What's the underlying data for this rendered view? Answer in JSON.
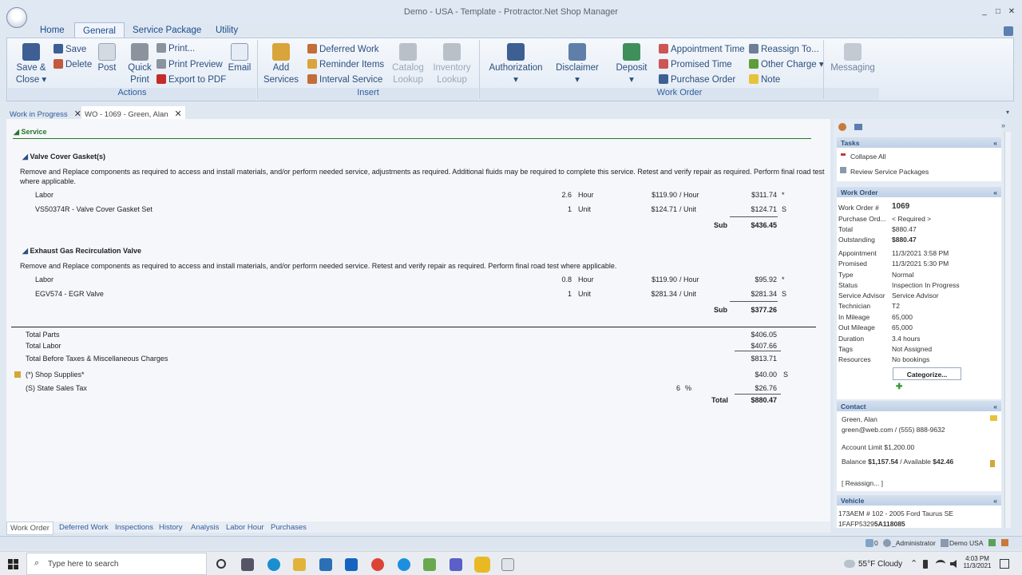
{
  "window": {
    "title": "Demo - USA - Template - Protractor.Net Shop Manager",
    "minimize": "_",
    "restore": "□",
    "close": "✕"
  },
  "ribbon_tabs": [
    "Home",
    "General",
    "Service Package",
    "Utility"
  ],
  "actions": {
    "save_close": "Save &",
    "close": "Close",
    "save": "Save",
    "delete": "Delete",
    "post": "Post",
    "print": "Print...",
    "print_preview": "Print Preview",
    "export_pdf": "Export to PDF",
    "quick": "Quick",
    "print2": "Print",
    "email": "Email",
    "group": "Actions"
  },
  "insert": {
    "add": "Add",
    "services": "Services",
    "deferred": "Deferred Work",
    "reminder": "Reminder Items",
    "interval": "Interval Service",
    "catalog": "Catalog",
    "lookup1": "Lookup",
    "inventory": "Inventory",
    "lookup2": "Lookup",
    "group": "Insert"
  },
  "workorder_grp": {
    "authorization": "Authorization",
    "disclaimer": "Disclaimer",
    "deposit": "Deposit",
    "appointment_time": "Appointment Time",
    "promised_time": "Promised Time",
    "purchase_order": "Purchase Order",
    "reassign": "Reassign To...",
    "other_charge": "Other Charge",
    "note": "Note",
    "messaging": "Messaging",
    "group": "Work Order"
  },
  "doc_tabs": [
    "Work in Progress",
    "WO - 1069 - Green, Alan"
  ],
  "service": {
    "header": "Service",
    "items": [
      {
        "title": "Valve Cover Gasket(s)",
        "desc1": "Remove and Replace components as required to access and install materials, and/or perform needed service, adjustments as required.  Additional fluids may be required to complete this service.  Retest and verify repair as required.  Perform final road test",
        "desc2": "where applicable.",
        "lines": [
          {
            "desc": "Labor",
            "qty": "2.6",
            "unit": "Hour",
            "price": "$119.90",
            "per": "/ Hour",
            "total": "$311.74",
            "flag": "*"
          },
          {
            "desc": "VS50374R - Valve Cover Gasket Set",
            "qty": "1",
            "unit": "Unit",
            "price": "$124.71",
            "per": "/ Unit",
            "total": "$124.71",
            "flag": "S"
          }
        ],
        "sub_label": "Sub",
        "sub": "$436.45"
      },
      {
        "title": "Exhaust Gas Recirculation Valve",
        "desc1": "Remove and Replace components as required to access and install materials, and/or perform needed service.  Retest and verify repair as required.  Perform final road test where applicable.",
        "desc2": "",
        "lines": [
          {
            "desc": "Labor",
            "qty": "0.8",
            "unit": "Hour",
            "price": "$119.90",
            "per": "/ Hour",
            "total": "$95.92",
            "flag": "*"
          },
          {
            "desc": "EGV574 - EGR Valve",
            "qty": "1",
            "unit": "Unit",
            "price": "$281.34",
            "per": "/ Unit",
            "total": "$281.34",
            "flag": "S"
          }
        ],
        "sub_label": "Sub",
        "sub": "$377.26"
      }
    ]
  },
  "totals": {
    "parts_label": "Total Parts",
    "parts": "$406.05",
    "labor_label": "Total Labor",
    "labor": "$407.66",
    "before_label": "Total Before Taxes & Miscellaneous Charges",
    "before": "$813.71",
    "supplies_label": "(*) Shop Supplies*",
    "supplies": "$40.00",
    "supplies_flag": "S",
    "tax_label": "(S) State Sales Tax",
    "tax_rate": "6",
    "tax_pct": "%",
    "tax": "$26.76",
    "total_label": "Total",
    "total": "$880.47"
  },
  "bottom_tabs": [
    "Work Order",
    "Deferred Work",
    "Inspections",
    "History",
    "Analysis",
    "Labor Hour",
    "Purchases"
  ],
  "panel": {
    "tasks_hdr": "Tasks",
    "collapse": "Collapse All",
    "review": "Review Service Packages",
    "wo_hdr": "Work Order",
    "wo_fields": [
      [
        "Work Order #",
        "1069"
      ],
      [
        "Purchase Ord...",
        "< Required >"
      ],
      [
        "Total",
        "$880.47"
      ],
      [
        "Outstanding",
        "$880.47"
      ],
      [
        "Appointment",
        "11/3/2021 3:58 PM"
      ],
      [
        "Promised",
        "11/3/2021 5:30 PM"
      ],
      [
        "Type",
        "Normal"
      ],
      [
        "Status",
        "Inspection In Progress"
      ],
      [
        "Service Advisor",
        "Service Advisor"
      ],
      [
        "Technician",
        "T2"
      ],
      [
        "In Mileage",
        "65,000"
      ],
      [
        "Out Mileage",
        "65,000"
      ],
      [
        "Duration",
        "3.4 hours"
      ],
      [
        "Tags",
        "Not Assigned"
      ],
      [
        "Resources",
        "No bookings"
      ]
    ],
    "categorize": "Categorize...",
    "contact_hdr": "Contact",
    "contact_name": "Green, Alan",
    "contact_info": "green@web.com / (555) 888-9632",
    "account_limit": "Account Limit $1,200.00",
    "balance_pre": "Balance ",
    "balance": "$1,157.54",
    "available_pre": " / Available ",
    "available": "$42.46",
    "reassign": "[ Reassign... ]",
    "vehicle_hdr": "Vehicle",
    "vehicle_line": "173AEM # 102 - 2005 Ford Taurus SE",
    "vin_pre": "1FAFP5329",
    "vin_bold": "5A118085"
  },
  "status": {
    "count": "0",
    "user": "_Administrator",
    "org": "Demo USA"
  },
  "taskbar": {
    "search": "Type here to search",
    "weather": "55°F  Cloudy",
    "time": "4:03 PM",
    "date": "11/3/2021"
  }
}
